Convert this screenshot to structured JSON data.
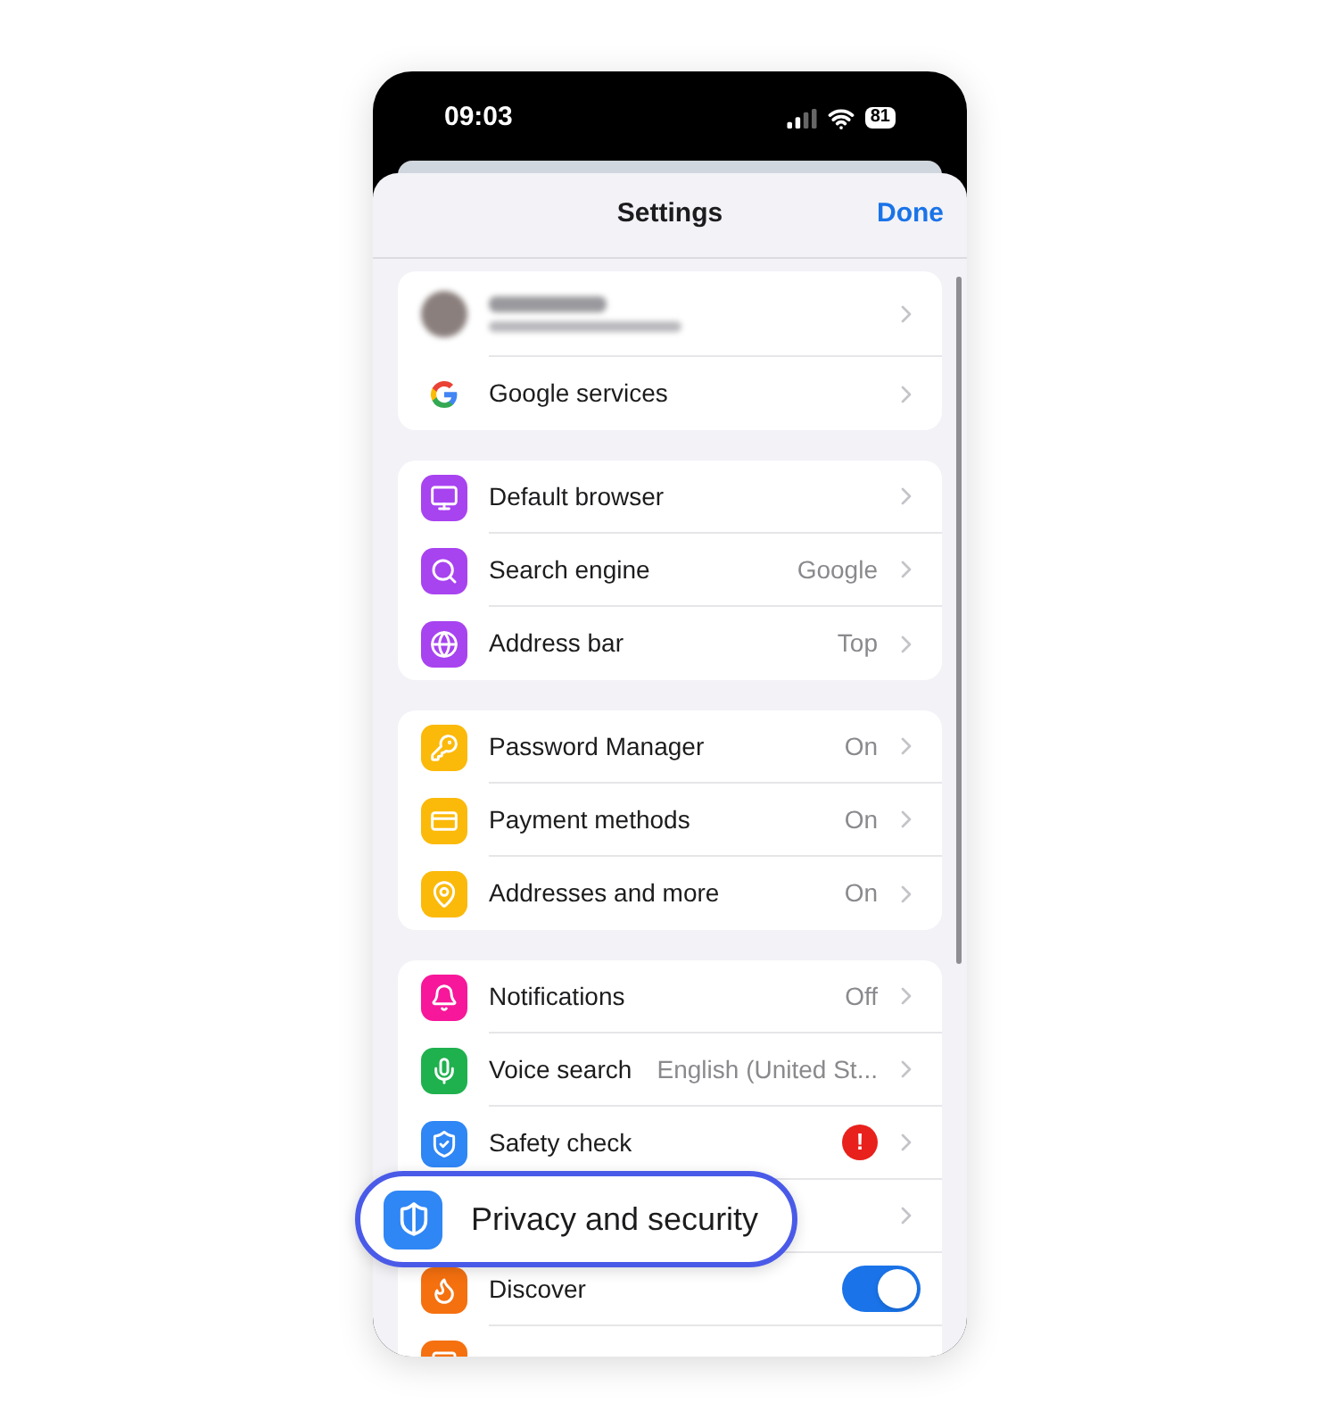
{
  "status_bar": {
    "time": "09:03",
    "battery": "81"
  },
  "header": {
    "title": "Settings",
    "done": "Done"
  },
  "groups": [
    {
      "rows": [
        {
          "kind": "account",
          "chevron": true
        },
        {
          "kind": "google",
          "label": "Google services",
          "chevron": true
        }
      ]
    },
    {
      "rows": [
        {
          "kind": "icon",
          "label": "Default browser",
          "color": "#a843f0",
          "chevron": true
        },
        {
          "kind": "icon",
          "label": "Search engine",
          "color": "#a843f0",
          "value": "Google",
          "chevron": true
        },
        {
          "kind": "icon",
          "label": "Address bar",
          "color": "#a843f0",
          "value": "Top",
          "chevron": true
        }
      ]
    },
    {
      "rows": [
        {
          "kind": "icon",
          "label": "Password Manager",
          "color": "#fbb90a",
          "value": "On",
          "chevron": true
        },
        {
          "kind": "icon",
          "label": "Payment methods",
          "color": "#fbb90a",
          "value": "On",
          "chevron": true
        },
        {
          "kind": "icon",
          "label": "Addresses and more",
          "color": "#fbb90a",
          "value": "On",
          "chevron": true
        }
      ]
    },
    {
      "rows": [
        {
          "kind": "icon",
          "label": "Notifications",
          "color": "#f7179a",
          "value": "Off",
          "chevron": true
        },
        {
          "kind": "icon",
          "label": "Voice search",
          "color": "#1fb14e",
          "value": "English (United St...",
          "chevron": true
        },
        {
          "kind": "icon",
          "label": "Safety check",
          "color": "#2f86f5",
          "alert": "!",
          "chevron": true
        },
        {
          "kind": "highlighted",
          "label": "Privacy and security",
          "color": "#2f86f5",
          "chevron": true
        },
        {
          "kind": "icon",
          "label": "Discover",
          "color": "#f5700f",
          "toggle": {
            "on": true
          },
          "chevron": false
        },
        {
          "kind": "partial",
          "color": "#f5700f",
          "chevron": false
        }
      ]
    }
  ]
}
